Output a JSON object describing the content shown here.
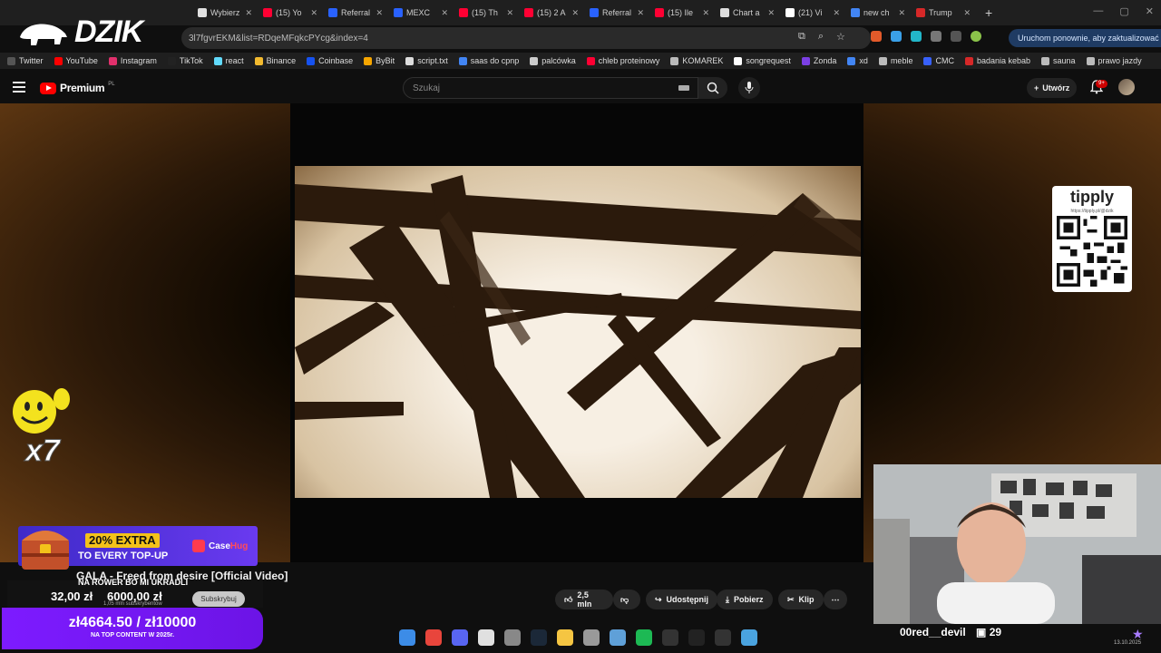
{
  "browser": {
    "tabs": [
      {
        "label": "Wybierz",
        "color": "#e0e0e0"
      },
      {
        "label": "(15) Yo",
        "color": "#ff0033"
      },
      {
        "label": "Referral",
        "color": "#2962ff"
      },
      {
        "label": "MEXC",
        "color": "#2962ff"
      },
      {
        "label": "(15) Th",
        "color": "#ff0033"
      },
      {
        "label": "(15) 2 A",
        "color": "#ff0033"
      },
      {
        "label": "Referral",
        "color": "#2962ff"
      },
      {
        "label": "(15) Ile",
        "color": "#ff0033"
      },
      {
        "label": "Chart a",
        "color": "#dddddd"
      },
      {
        "label": "(21) Vi",
        "color": "#ffffff"
      },
      {
        "label": "new ch",
        "color": "#4285f4"
      },
      {
        "label": "Trump",
        "color": "#d62828"
      }
    ],
    "url": "3l7fgvrEKM&list=RDqeMFqkcPYcg&index=4",
    "update_label": "Uruchom ponownie, aby zaktualizować",
    "bookmarks": [
      {
        "label": "Twitter",
        "color": "#555555"
      },
      {
        "label": "YouTube",
        "color": "#ff0000"
      },
      {
        "label": "Instagram",
        "color": "#e1306c"
      },
      {
        "label": "TikTok",
        "color": "#222222"
      },
      {
        "label": "react",
        "color": "#61dafb"
      },
      {
        "label": "Binance",
        "color": "#f3ba2f"
      },
      {
        "label": "Coinbase",
        "color": "#1652f0"
      },
      {
        "label": "ByBit",
        "color": "#f7a600"
      },
      {
        "label": "script.txt",
        "color": "#dddddd"
      },
      {
        "label": "saas do cpnp",
        "color": "#4285f4"
      },
      {
        "label": "palcówka",
        "color": "#cccccc"
      },
      {
        "label": "chleb proteinowy",
        "color": "#ff0033"
      },
      {
        "label": "KOMAREK",
        "color": "#bbbbbb"
      },
      {
        "label": "songrequest",
        "color": "#ffffff"
      },
      {
        "label": "Zonda",
        "color": "#7b3fe4"
      },
      {
        "label": "xd",
        "color": "#4285f4"
      },
      {
        "label": "meble",
        "color": "#bbbbbb"
      },
      {
        "label": "CMC",
        "color": "#3861fb"
      },
      {
        "label": "badania kebab",
        "color": "#d62828"
      },
      {
        "label": "sauna",
        "color": "#bbbbbb"
      },
      {
        "label": "prawo jazdy",
        "color": "#bbbbbb"
      }
    ]
  },
  "overlay": {
    "channel_logo": "DZIK",
    "tipply_title": "tipply",
    "tipply_url": "https://tipply.pl/@dzik",
    "combo": "x7",
    "promo_extra": "20% EXTRA",
    "promo_sub": "TO EVERY TOP-UP",
    "promo_brand_a": "Case",
    "promo_brand_b": "Hug",
    "stream_message": "NA ROWER BO MI UKRADLI",
    "goal_current": "32,00 zł",
    "goal_target": "6000,00 zł",
    "donation_amount": "zł4664.50 / zł10000",
    "donation_sub": "NA TOP CONTENT W 2025r.",
    "cam_name": "00red__devil",
    "cam_count": "29",
    "clock": "13.10.2025"
  },
  "youtube": {
    "logo_label": "Premium",
    "region": "PL",
    "search_placeholder": "Szukaj",
    "create_label": "Utwórz",
    "notif_badge": "9+",
    "video_title": "GALA - Freed from desire [Official Video]",
    "subs_count": "1,05 mln subskrybentów",
    "subscribe_label": "Subskrybuj",
    "likes": "2,5 mln",
    "share_label": "Udostępnij",
    "download_label": "Pobierz",
    "clip_label": "Klip"
  },
  "taskbar": {
    "icons": [
      {
        "name": "windows-start-icon",
        "color": "#3c8ce7"
      },
      {
        "name": "chrome-icon",
        "color": "#e8453c"
      },
      {
        "name": "discord-icon",
        "color": "#5865f2"
      },
      {
        "name": "app-icon",
        "color": "#e0e0e0"
      },
      {
        "name": "xbox-icon",
        "color": "#888888"
      },
      {
        "name": "steam-icon",
        "color": "#1b2838"
      },
      {
        "name": "folder-icon",
        "color": "#f5c542"
      },
      {
        "name": "ccleaner-icon",
        "color": "#999999"
      },
      {
        "name": "tool-icon",
        "color": "#5fa0d8"
      },
      {
        "name": "spotify-icon",
        "color": "#1db954"
      },
      {
        "name": "terminal-icon",
        "color": "#333333"
      },
      {
        "name": "obs-icon",
        "color": "#222222"
      },
      {
        "name": "epic-icon",
        "color": "#333333"
      },
      {
        "name": "notepad-icon",
        "color": "#4aa3df"
      }
    ]
  }
}
